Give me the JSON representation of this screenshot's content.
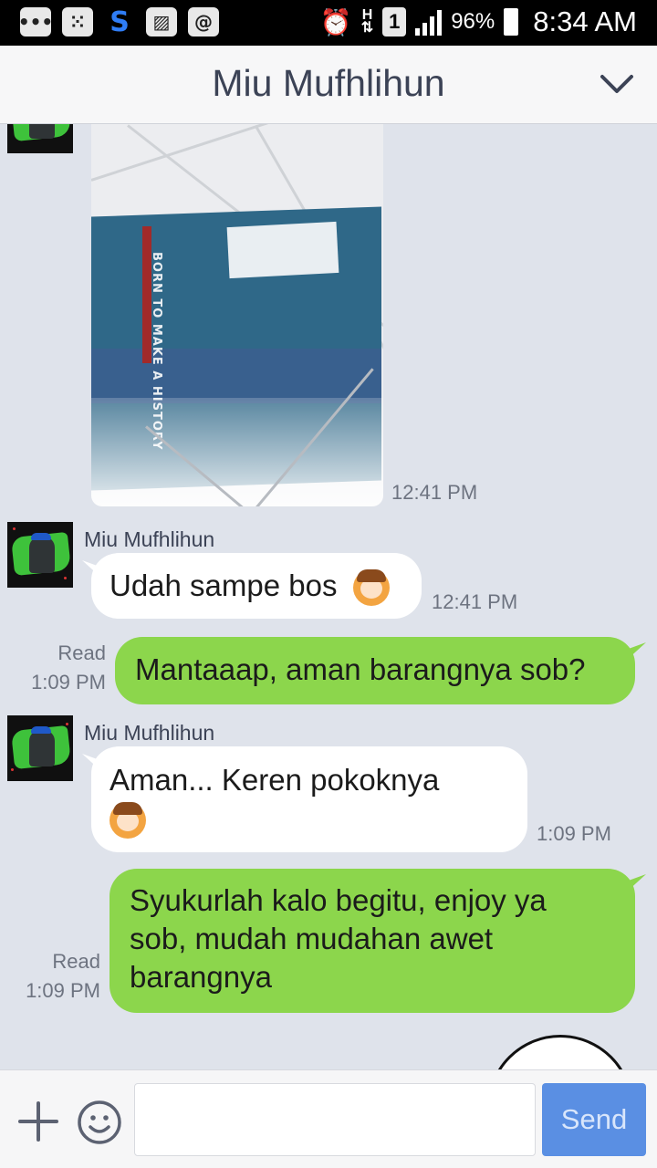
{
  "status_bar": {
    "battery": "96%",
    "time": "8:34 AM",
    "network": "H",
    "sim": "1"
  },
  "header": {
    "title": "Miu Mufhlihun"
  },
  "messages": [
    {
      "type": "image",
      "direction": "incoming",
      "time": "12:41 PM",
      "box_text": "BORN TO MAKE A HISTORY"
    },
    {
      "type": "text",
      "direction": "incoming",
      "sender": "Miu Mufhlihun",
      "text": "Udah sampe bos",
      "time": "12:41 PM"
    },
    {
      "type": "text",
      "direction": "outgoing",
      "text": "Mantaaap, aman barangnya sob?",
      "read": "Read",
      "time": "1:09 PM"
    },
    {
      "type": "text",
      "direction": "incoming",
      "sender": "Miu Mufhlihun",
      "text": "Aman... Keren pokoknya",
      "time": "1:09 PM"
    },
    {
      "type": "text",
      "direction": "outgoing",
      "text_lines": [
        "Syukurlah kalo begitu, enjoy ya",
        "sob, mudah mudahan awet",
        "barangnya"
      ],
      "read": "Read",
      "time": "1:09 PM"
    }
  ],
  "input_bar": {
    "placeholder": "",
    "send_label": "Send"
  },
  "colors": {
    "chat_bg": "#dfe3eb",
    "incoming_bubble": "#ffffff",
    "outgoing_bubble": "#8cd64c",
    "send_button": "#5a8fe3"
  }
}
